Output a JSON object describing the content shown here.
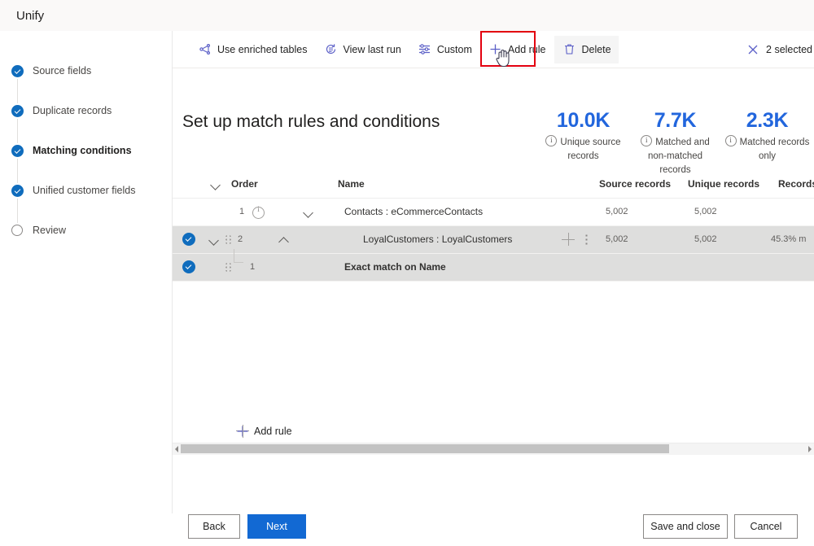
{
  "app": {
    "title": "Unify"
  },
  "wizard": {
    "steps": [
      {
        "label": "Source fields",
        "state": "done"
      },
      {
        "label": "Duplicate records",
        "state": "done"
      },
      {
        "label": "Matching conditions",
        "state": "current"
      },
      {
        "label": "Unified customer fields",
        "state": "done"
      },
      {
        "label": "Review",
        "state": "todo"
      }
    ]
  },
  "commandbar": {
    "items": [
      {
        "label": "Use enriched tables",
        "icon": "enriched-tables-icon"
      },
      {
        "label": "View last run",
        "icon": "history-icon"
      },
      {
        "label": "Custom",
        "icon": "sliders-icon"
      },
      {
        "label": "Add rule",
        "icon": "plus-icon"
      },
      {
        "label": "Delete",
        "icon": "trash-icon"
      }
    ],
    "selection_label": "2 selected",
    "close_icon": "close-icon",
    "highlight_color": "#e3000f"
  },
  "page": {
    "heading": "Set up match rules and conditions"
  },
  "kpis": [
    {
      "value": "10.0K",
      "caption_line1": "Unique source",
      "caption_line2": "records"
    },
    {
      "value": "7.7K",
      "caption_line1": "Matched and",
      "caption_line2": "non-matched records"
    },
    {
      "value": "2.3K",
      "caption_line1": "Matched records",
      "caption_line2": "only"
    }
  ],
  "table": {
    "headers": {
      "order": "Order",
      "name": "Name",
      "source_records": "Source records",
      "unique_records": "Unique records",
      "records": "Records"
    },
    "rows": [
      {
        "selected": false,
        "order": "1",
        "name": "Contacts : eCommerceContacts",
        "source_records": "5,002",
        "unique_records": "5,002",
        "records": ""
      },
      {
        "selected": true,
        "order": "2",
        "name": "LoyalCustomers : LoyalCustomers",
        "source_records": "5,002",
        "unique_records": "5,002",
        "records": "45.3% m"
      },
      {
        "selected": true,
        "order": "1",
        "name": "Exact match on Name",
        "source_records": "",
        "unique_records": "",
        "records": ""
      }
    ],
    "add_rule_label": "Add rule"
  },
  "footer": {
    "back": "Back",
    "next": "Next",
    "save_and_close": "Save and close",
    "cancel": "Cancel",
    "primary_color": "#1269d3"
  }
}
